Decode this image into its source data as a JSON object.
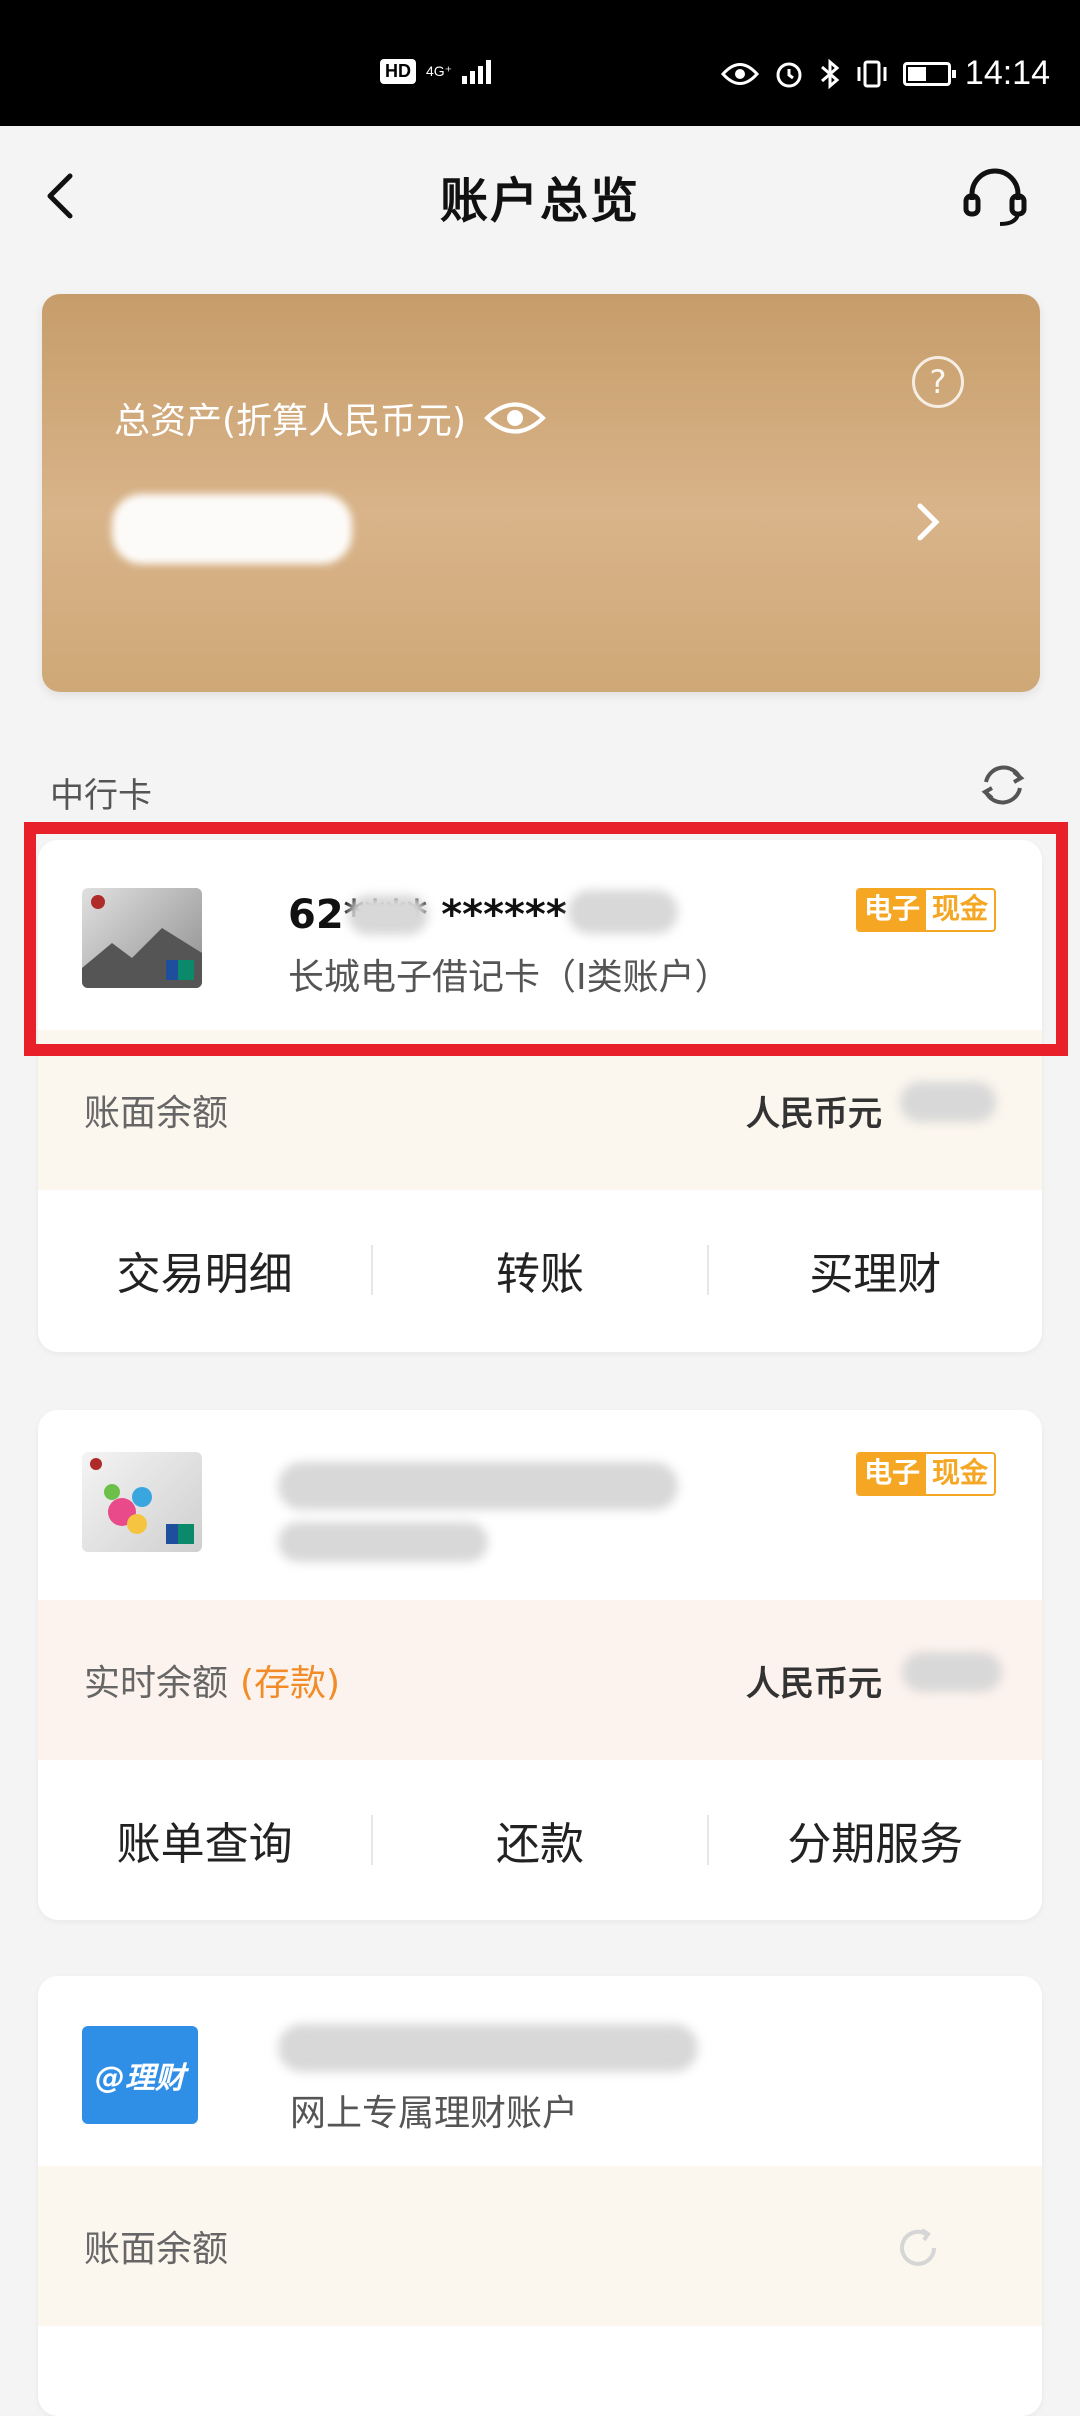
{
  "status_bar": {
    "time": "14:14",
    "hd": "HD",
    "network": "4G⁺",
    "battery_level": 0.45
  },
  "nav": {
    "title": "账户总览"
  },
  "assets": {
    "label": "总资产(折算人民币元)"
  },
  "section": {
    "label": "中行卡"
  },
  "cards": [
    {
      "number": "62**** ******",
      "name": "长城电子借记卡（I类账户）",
      "badge_a": "电子",
      "badge_b": "现金",
      "balance_label": "账面余额",
      "currency": "人民币元",
      "actions": [
        "交易明细",
        "转账",
        "买理财"
      ]
    },
    {
      "badge_a": "电子",
      "badge_b": "现金",
      "balance_label": "实时余额",
      "balance_tag": "(存款)",
      "currency": "人民币元",
      "actions": [
        "账单查询",
        "还款",
        "分期服务"
      ]
    },
    {
      "logo_text": "@理财",
      "name": "网上专属理财账户",
      "balance_label": "账面余额"
    }
  ],
  "colors": {
    "gold": "#d1a775",
    "badge_orange": "#f5a623",
    "highlight_red": "#e8202a"
  }
}
